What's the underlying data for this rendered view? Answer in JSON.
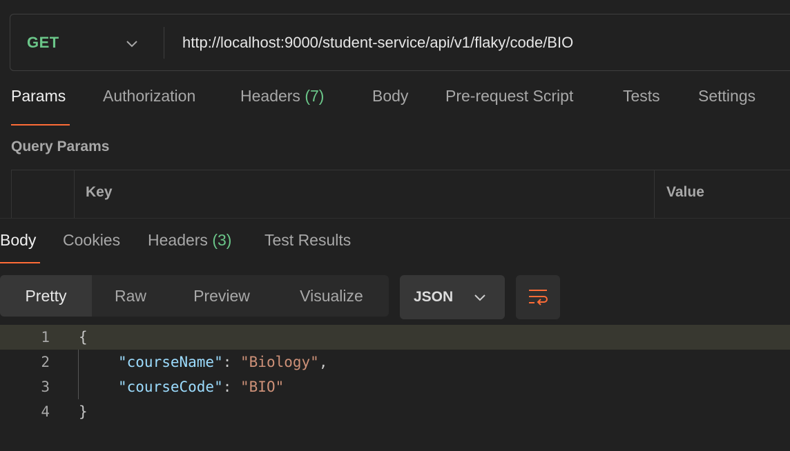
{
  "request": {
    "method": "GET",
    "url": "http://localhost:9000/student-service/api/v1/flaky/code/BIO"
  },
  "request_tabs": [
    {
      "label": "Params",
      "count": ""
    },
    {
      "label": "Authorization",
      "count": ""
    },
    {
      "label": "Headers ",
      "count": "(7)"
    },
    {
      "label": "Body",
      "count": ""
    },
    {
      "label": "Pre-request Script",
      "count": ""
    },
    {
      "label": "Tests",
      "count": ""
    },
    {
      "label": "Settings",
      "count": ""
    }
  ],
  "query_params": {
    "title": "Query Params",
    "columns": {
      "key": "Key",
      "value": "Value"
    }
  },
  "response_tabs": [
    {
      "label": "Body",
      "count": ""
    },
    {
      "label": "Cookies",
      "count": ""
    },
    {
      "label": "Headers ",
      "count": "(3)"
    },
    {
      "label": "Test Results",
      "count": ""
    }
  ],
  "format_buttons": [
    "Pretty",
    "Raw",
    "Preview",
    "Visualize"
  ],
  "language": "JSON",
  "code_lines": [
    {
      "num": "1",
      "text": "{"
    },
    {
      "num": "2",
      "key": "\"courseName\"",
      "sep": ": ",
      "value": "\"Biology\"",
      "end": ","
    },
    {
      "num": "3",
      "key": "\"courseCode\"",
      "sep": ": ",
      "value": "\"BIO\"",
      "end": ""
    },
    {
      "num": "4",
      "text": "}"
    }
  ],
  "colors": {
    "accent": "#ff6c37",
    "method_get": "#6bc689",
    "json_key": "#9cdcfe",
    "json_string": "#ce9178"
  }
}
